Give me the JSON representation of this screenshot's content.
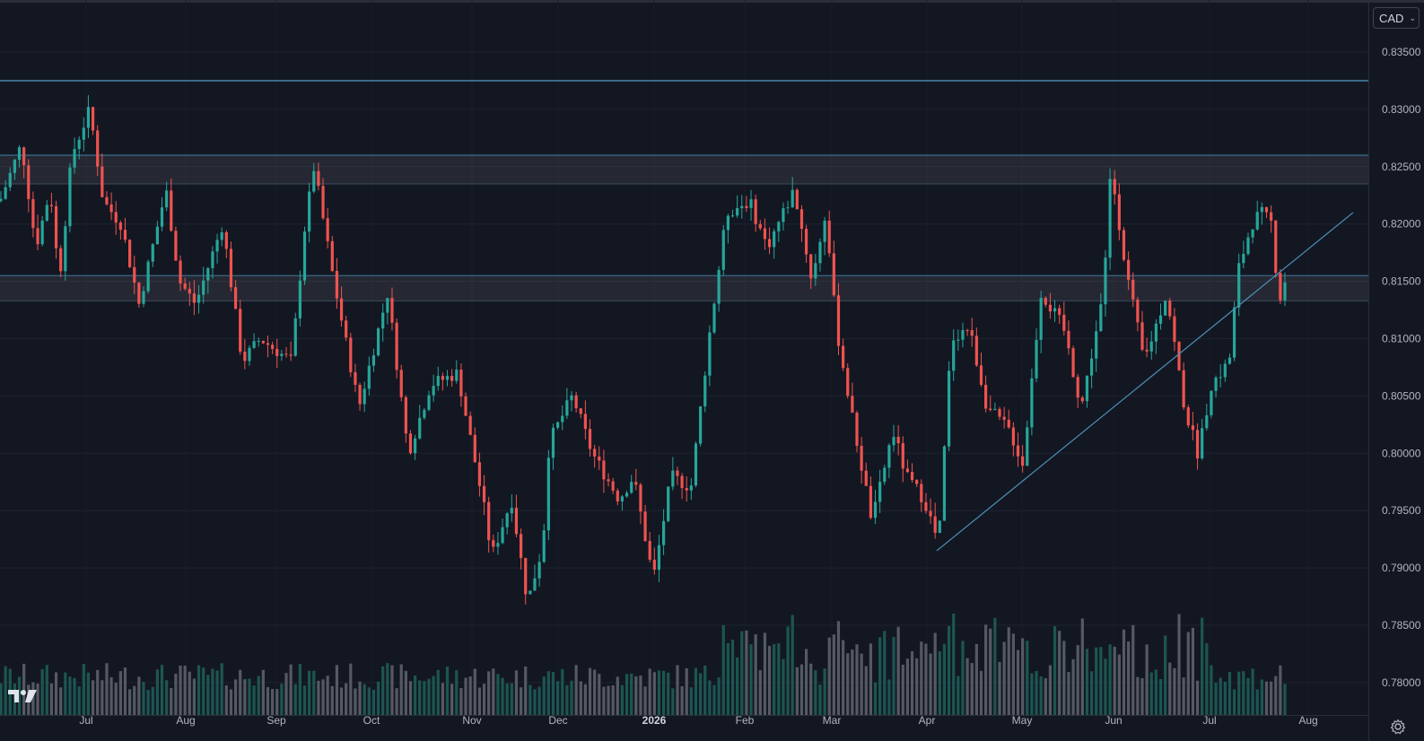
{
  "currency_selector": {
    "label": "CAD"
  },
  "colors": {
    "background": "#131722",
    "up": "#26a69a",
    "down": "#ef5350",
    "volume_up": "#1e5d57",
    "volume_down": "#5d606b",
    "drawing": "#4a90b8"
  },
  "icons": {
    "logo": "tradingview-logo",
    "settings": "settings-gear-icon"
  },
  "chart_data": {
    "type": "candlestick",
    "symbol_quote_currency": "CAD",
    "y_axis": {
      "ticks": [
        "0.83500",
        "0.83000",
        "0.82500",
        "0.82000",
        "0.81500",
        "0.81000",
        "0.80500",
        "0.80000",
        "0.79500",
        "0.79000",
        "0.78500",
        "0.78000"
      ],
      "range": [
        0.7775,
        0.839
      ]
    },
    "x_axis": {
      "ticks": [
        {
          "label": "Jul",
          "major": false
        },
        {
          "label": "Aug",
          "major": false
        },
        {
          "label": "Sep",
          "major": false
        },
        {
          "label": "Oct",
          "major": false
        },
        {
          "label": "Nov",
          "major": false
        },
        {
          "label": "Dec",
          "major": false
        },
        {
          "label": "2026",
          "major": true
        },
        {
          "label": "Feb",
          "major": false
        },
        {
          "label": "Mar",
          "major": false
        },
        {
          "label": "Apr",
          "major": false
        },
        {
          "label": "May",
          "major": false
        },
        {
          "label": "Jun",
          "major": false
        },
        {
          "label": "Jul",
          "major": false
        },
        {
          "label": "Aug",
          "major": false
        }
      ]
    },
    "price_path": [
      [
        0,
        0.822
      ],
      [
        24,
        0.827
      ],
      [
        40,
        0.818
      ],
      [
        56,
        0.823
      ],
      [
        66,
        0.815
      ],
      [
        80,
        0.826
      ],
      [
        100,
        0.83
      ],
      [
        115,
        0.822
      ],
      [
        135,
        0.82
      ],
      [
        155,
        0.813
      ],
      [
        185,
        0.823
      ],
      [
        200,
        0.815
      ],
      [
        218,
        0.813
      ],
      [
        248,
        0.82
      ],
      [
        270,
        0.808
      ],
      [
        290,
        0.81
      ],
      [
        325,
        0.808
      ],
      [
        340,
        0.82
      ],
      [
        350,
        0.825
      ],
      [
        372,
        0.815
      ],
      [
        400,
        0.804
      ],
      [
        432,
        0.814
      ],
      [
        455,
        0.8
      ],
      [
        480,
        0.806
      ],
      [
        510,
        0.807
      ],
      [
        540,
        0.795
      ],
      [
        548,
        0.791
      ],
      [
        570,
        0.796
      ],
      [
        588,
        0.787
      ],
      [
        605,
        0.792
      ],
      [
        612,
        0.801
      ],
      [
        638,
        0.805
      ],
      [
        660,
        0.8
      ],
      [
        690,
        0.796
      ],
      [
        706,
        0.798
      ],
      [
        728,
        0.789
      ],
      [
        748,
        0.798
      ],
      [
        770,
        0.797
      ],
      [
        790,
        0.81
      ],
      [
        810,
        0.821
      ],
      [
        835,
        0.822
      ],
      [
        855,
        0.818
      ],
      [
        885,
        0.823
      ],
      [
        905,
        0.815
      ],
      [
        920,
        0.821
      ],
      [
        932,
        0.811
      ],
      [
        950,
        0.803
      ],
      [
        972,
        0.794
      ],
      [
        995,
        0.802
      ],
      [
        1010,
        0.798
      ],
      [
        1030,
        0.796
      ],
      [
        1046,
        0.792
      ],
      [
        1060,
        0.81
      ],
      [
        1080,
        0.811
      ],
      [
        1100,
        0.804
      ],
      [
        1125,
        0.802
      ],
      [
        1140,
        0.799
      ],
      [
        1160,
        0.814
      ],
      [
        1185,
        0.811
      ],
      [
        1205,
        0.804
      ],
      [
        1230,
        0.814
      ],
      [
        1238,
        0.825
      ],
      [
        1255,
        0.816
      ],
      [
        1275,
        0.808
      ],
      [
        1300,
        0.814
      ],
      [
        1320,
        0.804
      ],
      [
        1335,
        0.8
      ],
      [
        1350,
        0.806
      ],
      [
        1370,
        0.808
      ],
      [
        1380,
        0.816
      ],
      [
        1395,
        0.82
      ],
      [
        1405,
        0.821
      ],
      [
        1418,
        0.82
      ],
      [
        1425,
        0.813
      ],
      [
        1431,
        0.815
      ]
    ],
    "candle_count": 280,
    "horizontal_levels": [
      0.8325
    ],
    "zones": [
      {
        "from": 0.8235,
        "to": 0.826
      },
      {
        "from": 0.8133,
        "to": 0.8155
      }
    ],
    "trendline": {
      "from": [
        "Apr",
        0.7915
      ],
      "to": [
        "Aug",
        0.821
      ]
    },
    "volume": {
      "min": 0.0,
      "max": 1.0
    },
    "last_price": 0.8152,
    "grid": true,
    "legend": "none"
  }
}
